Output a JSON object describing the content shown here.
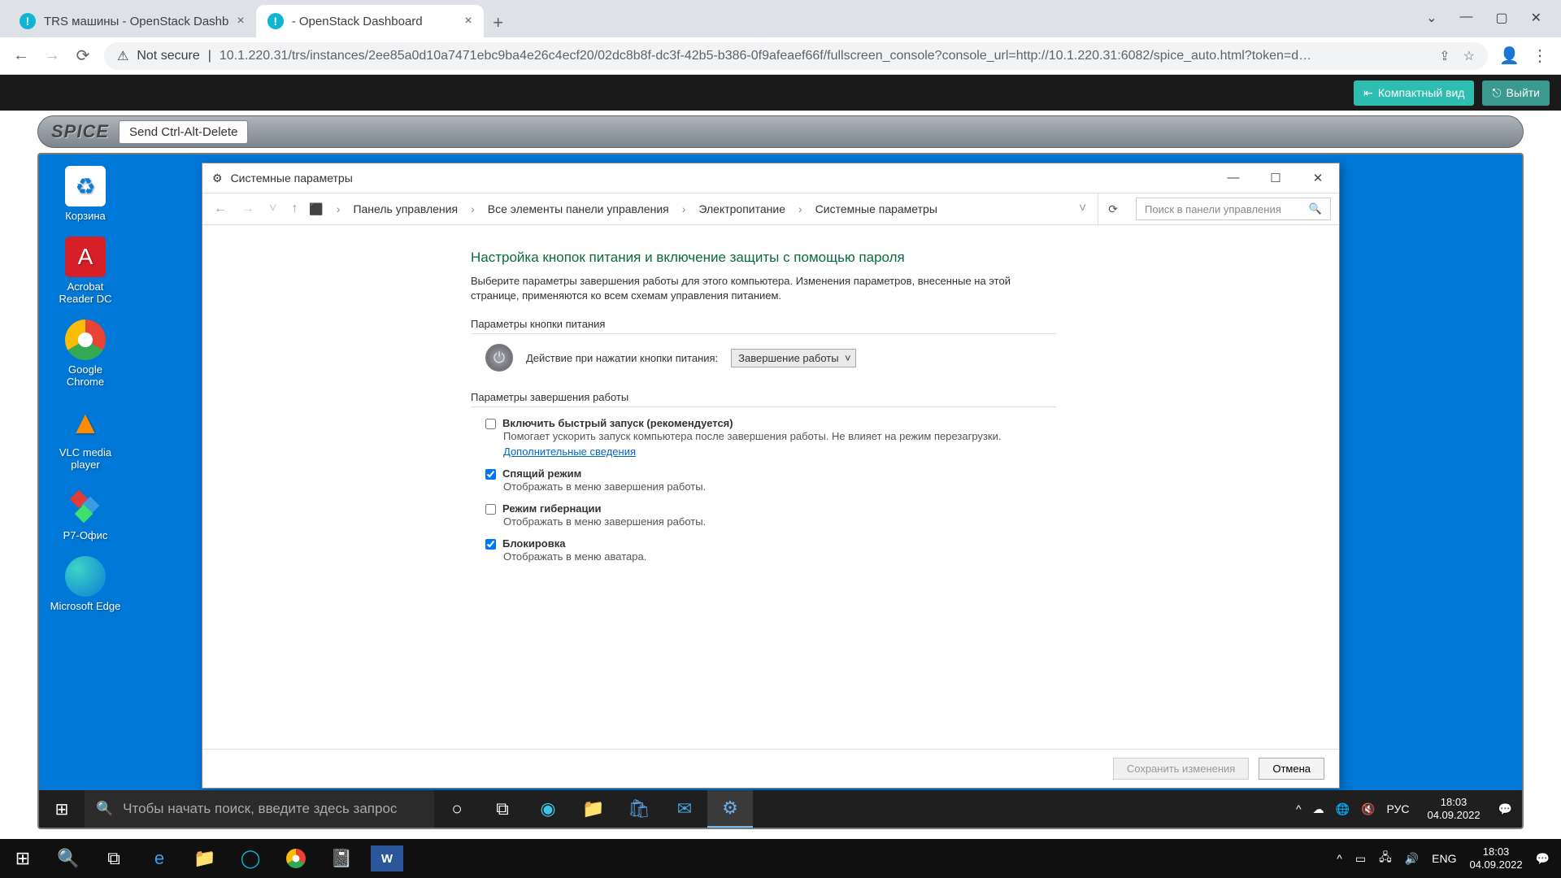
{
  "chrome": {
    "tab1": "TRS машины - OpenStack Dashb",
    "tab2": " - OpenStack Dashboard",
    "not_secure": "Not secure",
    "url": "10.1.220.31/trs/instances/2ee85a0d10a7471ebc9ba4e26c4ecf20/02dc8b8f-dc3f-42b5-b386-0f9afeaef66f/fullscreen_console?console_url=http://10.1.220.31:6082/spice_auto.html?token=d…"
  },
  "openstack": {
    "compact": "Компактный вид",
    "logout": "Выйти"
  },
  "spice": {
    "logo": "SPICE",
    "cad": "Send Ctrl-Alt-Delete"
  },
  "desktop": {
    "bin": "Корзина",
    "acrobat": "Acrobat Reader DC",
    "chrome": "Google Chrome",
    "vlc": "VLC media player",
    "r7": "Р7-Офис",
    "edge": "Microsoft Edge"
  },
  "cp": {
    "title": "Системные параметры",
    "crumb1": "Панель управления",
    "crumb2": "Все элементы панели управления",
    "crumb3": "Электропитание",
    "crumb4": "Системные параметры",
    "search_ph": "Поиск в панели управления",
    "h1": "Настройка кнопок питания и включение защиты с помощью пароля",
    "desc": "Выберите параметры завершения работы для этого компьютера. Изменения параметров, внесенные на этой странице, применяются ко всем схемам управления питанием.",
    "sect1": "Параметры кнопки питания",
    "power_label": "Действие при нажатии кнопки питания:",
    "power_option": "Завершение работы",
    "sect2": "Параметры завершения работы",
    "opt1": "Включить быстрый запуск (рекомендуется)",
    "opt1_sub_a": "Помогает ускорить запуск компьютера после завершения работы. Не влияет на режим перезагрузки. ",
    "opt1_link": "Дополнительные сведения",
    "opt2": "Спящий режим",
    "opt2_sub": "Отображать в меню завершения работы.",
    "opt3": "Режим гибернации",
    "opt3_sub": "Отображать в меню завершения работы.",
    "opt4": "Блокировка",
    "opt4_sub": "Отображать в меню аватара.",
    "save": "Сохранить изменения",
    "cancel": "Отмена"
  },
  "vm_taskbar": {
    "search_ph": "Чтобы начать поиск, введите здесь запрос",
    "lang": "РУС",
    "time": "18:03",
    "date": "04.09.2022"
  },
  "host_taskbar": {
    "lang": "ENG",
    "time": "18:03",
    "date": "04.09.2022"
  }
}
